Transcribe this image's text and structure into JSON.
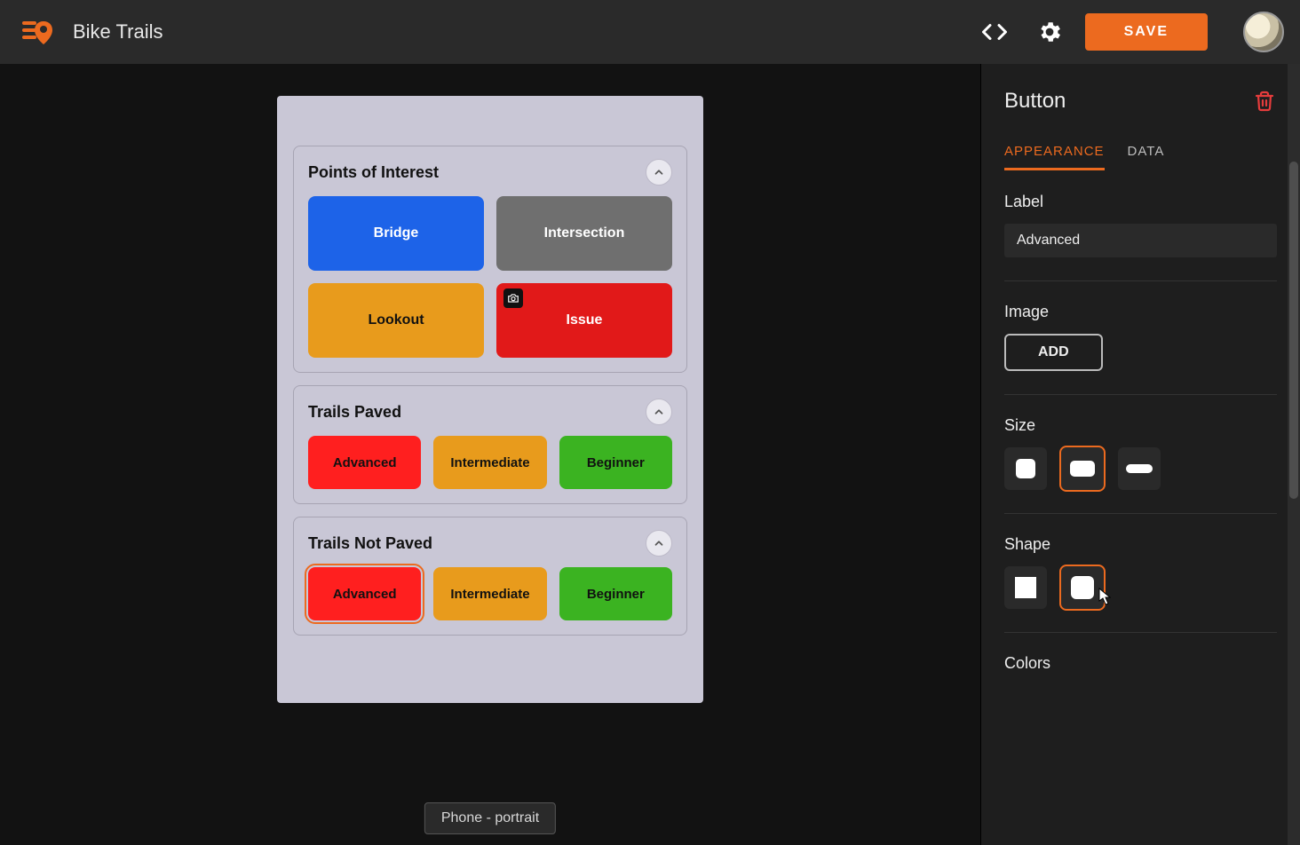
{
  "header": {
    "title": "Bike Trails",
    "save_label": "SAVE"
  },
  "viewport_label": "Phone - portrait",
  "accent_color": "#ec6a1f",
  "canvas": {
    "groups": [
      {
        "title": "Points of Interest",
        "layout": "2",
        "buttons": [
          {
            "label": "Bridge",
            "color": "#1d63e8",
            "text": "light",
            "camera": false,
            "selected": false
          },
          {
            "label": "Intersection",
            "color": "#6f6f6f",
            "text": "light",
            "camera": false,
            "selected": false
          },
          {
            "label": "Lookout",
            "color": "#e89b1c",
            "text": "dark",
            "camera": false,
            "selected": false
          },
          {
            "label": "Issue",
            "color": "#e11919",
            "text": "light",
            "camera": true,
            "selected": false
          }
        ]
      },
      {
        "title": "Trails Paved",
        "layout": "3",
        "buttons": [
          {
            "label": "Advanced",
            "color": "#ff1f1f",
            "text": "dark",
            "camera": false,
            "selected": false
          },
          {
            "label": "Intermediate",
            "color": "#e89b1c",
            "text": "dark",
            "camera": false,
            "selected": false
          },
          {
            "label": "Beginner",
            "color": "#3bb321",
            "text": "dark",
            "camera": false,
            "selected": false
          }
        ]
      },
      {
        "title": "Trails Not Paved",
        "layout": "3",
        "buttons": [
          {
            "label": "Advanced",
            "color": "#ff1f1f",
            "text": "dark",
            "camera": false,
            "selected": true
          },
          {
            "label": "Intermediate",
            "color": "#e89b1c",
            "text": "dark",
            "camera": false,
            "selected": false
          },
          {
            "label": "Beginner",
            "color": "#3bb321",
            "text": "dark",
            "camera": false,
            "selected": false
          }
        ]
      }
    ]
  },
  "inspector": {
    "title": "Button",
    "tabs": {
      "appearance": "APPEARANCE",
      "data": "DATA",
      "active": "appearance"
    },
    "label_section": {
      "heading": "Label",
      "value": "Advanced"
    },
    "image_section": {
      "heading": "Image",
      "add_label": "ADD"
    },
    "size_section": {
      "heading": "Size",
      "selected_index": 1
    },
    "shape_section": {
      "heading": "Shape",
      "selected_index": 1
    },
    "colors_section": {
      "heading": "Colors"
    }
  }
}
